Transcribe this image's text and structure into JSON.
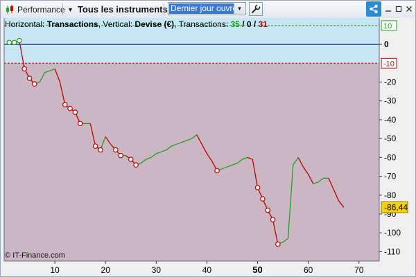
{
  "toolbar": {
    "performance_label": "Performance",
    "instruments_label": "Tous les instruments",
    "period_select_value": "Dernier jour ouvré",
    "icons": {
      "candle": "candlestick-icon",
      "dropdown": "chevron-down-icon",
      "wrench": "wrench-icon",
      "share": "share-icon",
      "minimize": "minimize-icon",
      "maximize": "maximize-icon",
      "close": "close-icon"
    }
  },
  "info": {
    "horizontal_prefix": "Horizontal: ",
    "horizontal_value": "Transactions",
    "vertical_prefix": ", Vertical: ",
    "vertical_value": "Devise (€)",
    "transactions_prefix": ", Transactions: ",
    "count_win": "35",
    "slash1": " / ",
    "count_neutral": "0",
    "slash2": " / ",
    "count_loss": "31"
  },
  "copyright": "© IT-Finance.com",
  "colors": {
    "up": "#20a020",
    "down": "#c00000",
    "zone_upper": "#c7e6f4",
    "zone_lower": "#cbb7c3",
    "zero_line": "#000080",
    "threshold_line": "#c00000",
    "upper_threshold_line": "#20a020",
    "last_value_bg": "#f5d300"
  },
  "chart_data": {
    "type": "line",
    "xlabel": "",
    "ylabel": "",
    "xlim": [
      0,
      74
    ],
    "ylim": [
      -115,
      14
    ],
    "x_ticks": [
      10,
      20,
      30,
      40,
      50,
      60,
      70
    ],
    "x_tick_highlight": 50,
    "y_ticks": [
      0,
      -20,
      -30,
      -40,
      -50,
      -60,
      -70,
      -80,
      -90,
      -100,
      -110
    ],
    "thresholds": [
      {
        "value": 10,
        "label": "10",
        "color": "green"
      },
      {
        "value": -10,
        "label": "-10",
        "color": "red"
      }
    ],
    "last_value_label": "-86,44",
    "last_value": -86.44,
    "points": [
      {
        "x": 1,
        "y": 1,
        "marker": "green"
      },
      {
        "x": 2,
        "y": 1,
        "marker": "green"
      },
      {
        "x": 3,
        "y": 2,
        "marker": "green"
      },
      {
        "x": 4,
        "y": -13,
        "marker": "red"
      },
      {
        "x": 5,
        "y": -18,
        "marker": "red"
      },
      {
        "x": 6,
        "y": -21,
        "marker": "red"
      },
      {
        "x": 7,
        "y": -20,
        "marker": ""
      },
      {
        "x": 8,
        "y": -15,
        "marker": ""
      },
      {
        "x": 9,
        "y": -14,
        "marker": ""
      },
      {
        "x": 10,
        "y": -13,
        "marker": ""
      },
      {
        "x": 11,
        "y": -20,
        "marker": ""
      },
      {
        "x": 12,
        "y": -32,
        "marker": "red"
      },
      {
        "x": 13,
        "y": -34,
        "marker": "red"
      },
      {
        "x": 14,
        "y": -36,
        "marker": "red"
      },
      {
        "x": 15,
        "y": -42,
        "marker": "red"
      },
      {
        "x": 16,
        "y": -42,
        "marker": ""
      },
      {
        "x": 17,
        "y": -42,
        "marker": ""
      },
      {
        "x": 18,
        "y": -54,
        "marker": "red"
      },
      {
        "x": 19,
        "y": -56,
        "marker": "red"
      },
      {
        "x": 20,
        "y": -49,
        "marker": ""
      },
      {
        "x": 21,
        "y": -53,
        "marker": ""
      },
      {
        "x": 22,
        "y": -56,
        "marker": "red"
      },
      {
        "x": 23,
        "y": -59,
        "marker": "red"
      },
      {
        "x": 24,
        "y": -59,
        "marker": ""
      },
      {
        "x": 25,
        "y": -61,
        "marker": "red"
      },
      {
        "x": 26,
        "y": -64,
        "marker": "red"
      },
      {
        "x": 27,
        "y": -63,
        "marker": ""
      },
      {
        "x": 28,
        "y": -61,
        "marker": ""
      },
      {
        "x": 29,
        "y": -60,
        "marker": ""
      },
      {
        "x": 30,
        "y": -58,
        "marker": ""
      },
      {
        "x": 31,
        "y": -57,
        "marker": ""
      },
      {
        "x": 32,
        "y": -56,
        "marker": ""
      },
      {
        "x": 33,
        "y": -54,
        "marker": ""
      },
      {
        "x": 34,
        "y": -53,
        "marker": ""
      },
      {
        "x": 35,
        "y": -52,
        "marker": ""
      },
      {
        "x": 36,
        "y": -51,
        "marker": ""
      },
      {
        "x": 37,
        "y": -50,
        "marker": ""
      },
      {
        "x": 38,
        "y": -48,
        "marker": ""
      },
      {
        "x": 40,
        "y": -58,
        "marker": ""
      },
      {
        "x": 41,
        "y": -62,
        "marker": ""
      },
      {
        "x": 42,
        "y": -67,
        "marker": "red"
      },
      {
        "x": 43,
        "y": -66,
        "marker": ""
      },
      {
        "x": 44,
        "y": -65,
        "marker": ""
      },
      {
        "x": 45,
        "y": -64,
        "marker": ""
      },
      {
        "x": 46,
        "y": -63,
        "marker": ""
      },
      {
        "x": 47,
        "y": -61,
        "marker": ""
      },
      {
        "x": 48,
        "y": -60,
        "marker": ""
      },
      {
        "x": 49,
        "y": -61,
        "marker": ""
      },
      {
        "x": 50,
        "y": -76,
        "marker": "red"
      },
      {
        "x": 51,
        "y": -82,
        "marker": "red"
      },
      {
        "x": 52,
        "y": -88,
        "marker": "red"
      },
      {
        "x": 53,
        "y": -93,
        "marker": "red"
      },
      {
        "x": 54,
        "y": -106,
        "marker": "red"
      },
      {
        "x": 55,
        "y": -105,
        "marker": ""
      },
      {
        "x": 56,
        "y": -103,
        "marker": ""
      },
      {
        "x": 57,
        "y": -64,
        "marker": ""
      },
      {
        "x": 58,
        "y": -60,
        "marker": ""
      },
      {
        "x": 59,
        "y": -65,
        "marker": ""
      },
      {
        "x": 60,
        "y": -69,
        "marker": ""
      },
      {
        "x": 61,
        "y": -74,
        "marker": ""
      },
      {
        "x": 62,
        "y": -73,
        "marker": ""
      },
      {
        "x": 63,
        "y": -71,
        "marker": ""
      },
      {
        "x": 64,
        "y": -71,
        "marker": ""
      },
      {
        "x": 65,
        "y": -77,
        "marker": ""
      },
      {
        "x": 66,
        "y": -83,
        "marker": ""
      },
      {
        "x": 67,
        "y": -86.44,
        "marker": ""
      }
    ]
  }
}
